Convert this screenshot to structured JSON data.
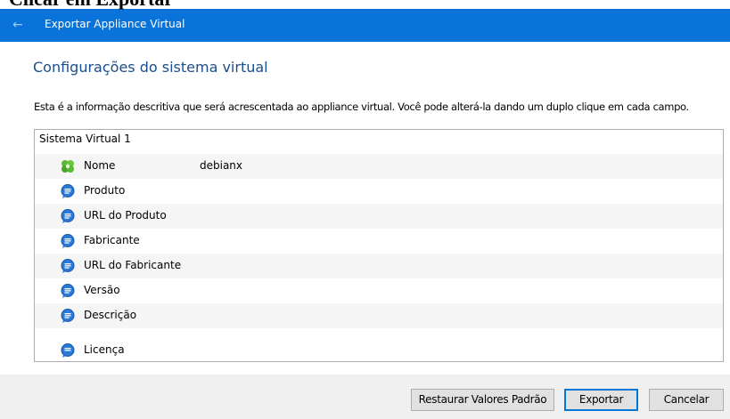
{
  "overlay_caption": "Clicar em Exportar",
  "window": {
    "title": "Exportar Appliance Virtual",
    "back_icon": "back-arrow-icon"
  },
  "section": {
    "title": "Configurações do sistema virtual",
    "description": "Esta é a informação descritiva que será acrescentada ao appliance virtual. Você pode alterá-la dando um duplo clique em cada campo."
  },
  "tree": {
    "root_label": "Sistema Virtual 1",
    "rows": [
      {
        "icon": "name-gear-icon",
        "label": "Nome",
        "value": "debianx"
      },
      {
        "icon": "speech-bubble-icon",
        "label": "Produto",
        "value": ""
      },
      {
        "icon": "speech-bubble-icon",
        "label": "URL do Produto",
        "value": ""
      },
      {
        "icon": "speech-bubble-icon",
        "label": "Fabricante",
        "value": ""
      },
      {
        "icon": "speech-bubble-icon",
        "label": "URL do Fabricante",
        "value": ""
      },
      {
        "icon": "speech-bubble-icon",
        "label": "Versão",
        "value": ""
      },
      {
        "icon": "speech-bubble-icon",
        "label": "Descrição",
        "value": ""
      },
      {
        "icon": "speech-bubble-icon",
        "label": "Licença",
        "value": ""
      }
    ]
  },
  "footer": {
    "restore_label": "Restaurar Valores Padrão",
    "export_label": "Exportar",
    "cancel_label": "Cancelar"
  },
  "colors": {
    "titlebar": "#0a73d9",
    "section_title": "#1a4e8c",
    "bubble_icon": "#1f6fd0",
    "name_icon": "#5bb832"
  }
}
